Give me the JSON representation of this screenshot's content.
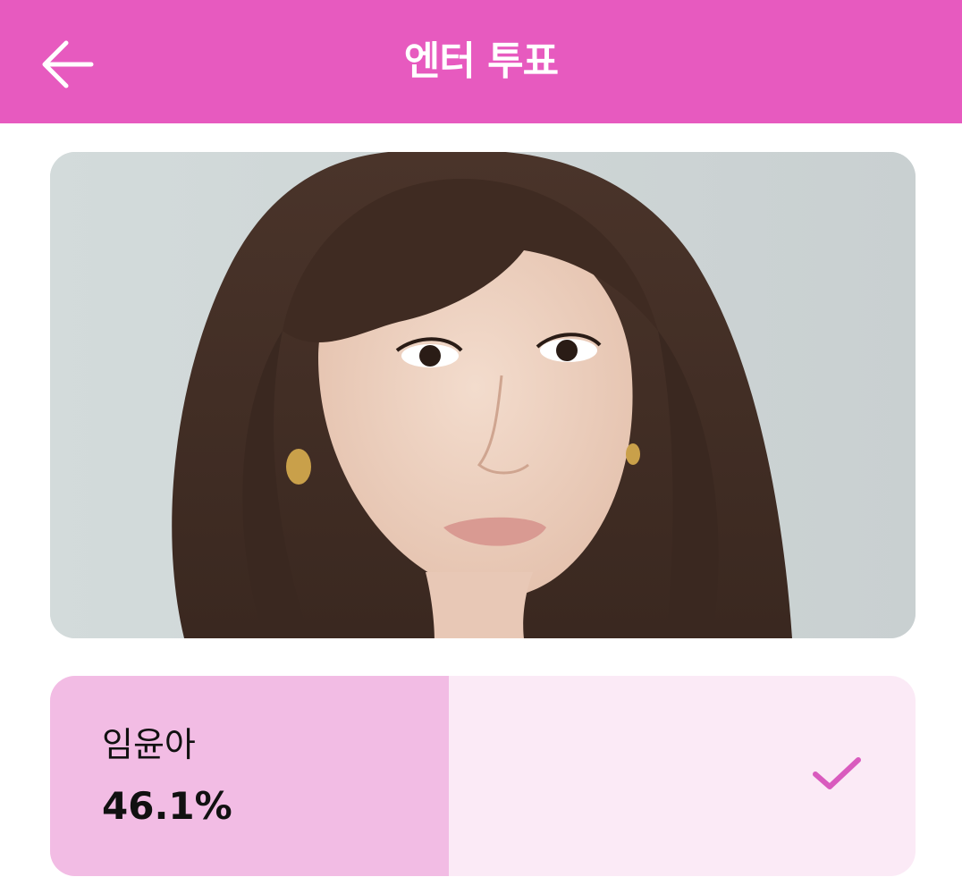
{
  "header": {
    "title": "엔터 투표",
    "back_icon": "arrow-left-icon",
    "background": "#E75ABF"
  },
  "photo": {
    "description_icon": "portrait-photo"
  },
  "vote": {
    "candidate_name": "임윤아",
    "percent_label": "46.1%",
    "percent_value": 46.1,
    "selected": true,
    "check_icon": "check-icon",
    "fill_color": "#F2BCE4",
    "track_color": "#FBEAF6",
    "accent_color": "#D95BBE"
  }
}
